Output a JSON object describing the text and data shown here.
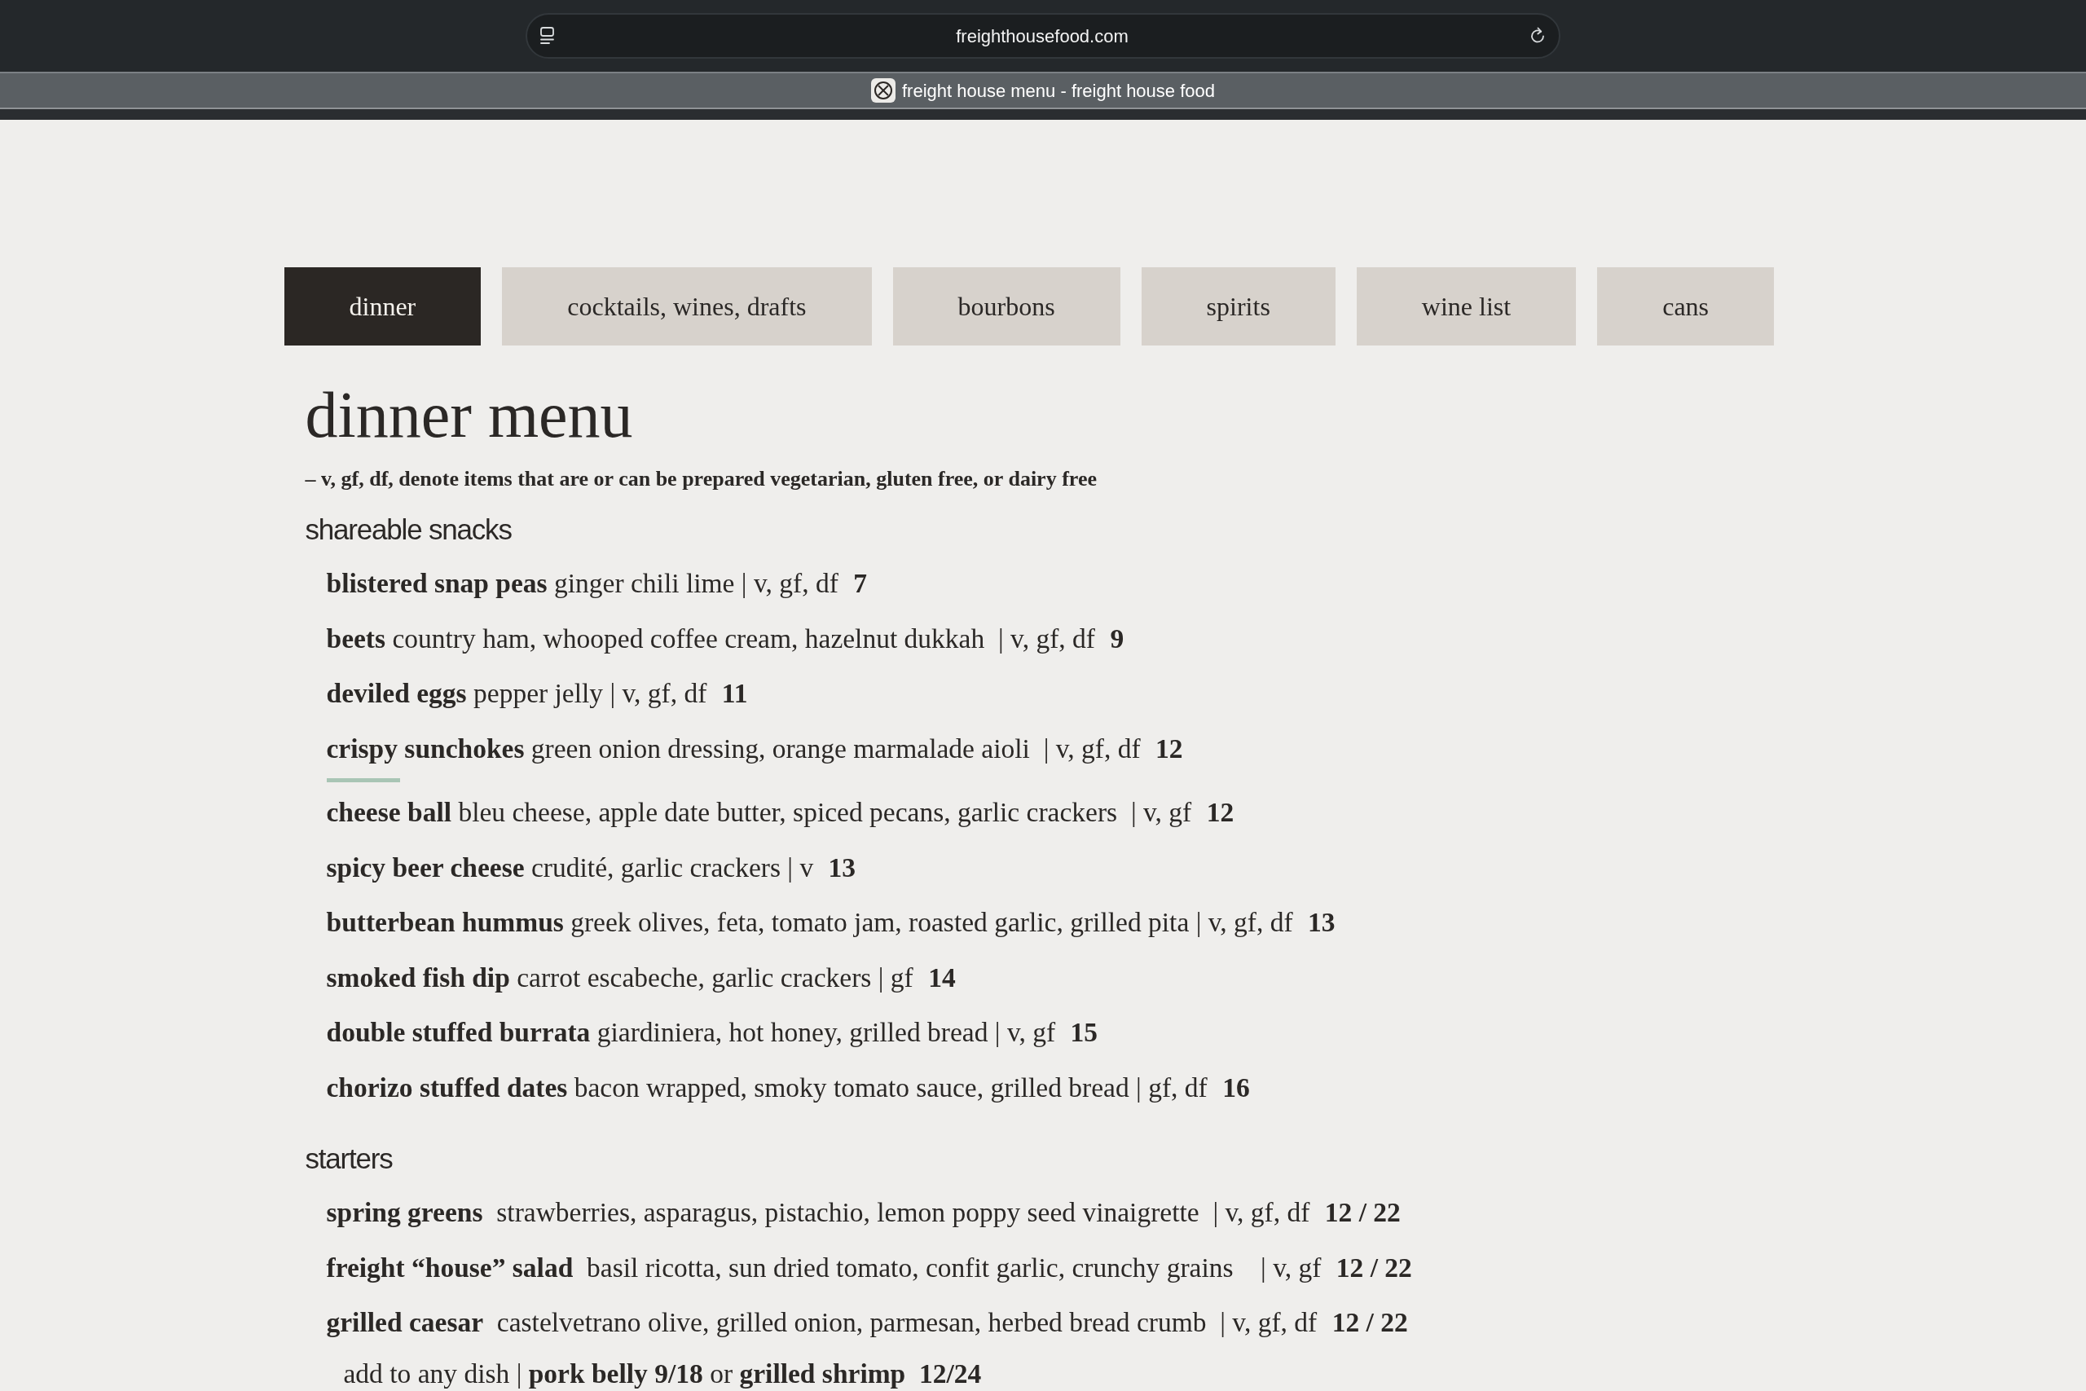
{
  "browser": {
    "url": "freighthousefood.com",
    "tab_title": "freight house menu - freight house food"
  },
  "menu_tabs": [
    {
      "label": "dinner",
      "selected": true
    },
    {
      "label": "cocktails, wines, drafts",
      "selected": false
    },
    {
      "label": "bourbons",
      "selected": false
    },
    {
      "label": "spirits",
      "selected": false
    },
    {
      "label": "wine list",
      "selected": false
    },
    {
      "label": "cans",
      "selected": false
    }
  ],
  "page": {
    "heading": "dinner menu",
    "note": "– v, gf, df, denote items that are or can be prepared vegetarian, gluten free, or dairy free"
  },
  "sections": [
    {
      "title": "shareable snacks",
      "items": [
        {
          "kind": "dish",
          "name": "blistered snap peas",
          "description": "ginger chili lime | v, gf, df",
          "price": "7"
        },
        {
          "kind": "dish",
          "name": "beets",
          "description": "country ham, whooped coffee cream, hazelnut dukkah  | v, gf, df",
          "price": "9"
        },
        {
          "kind": "dish",
          "name": "deviled eggs",
          "description": "pepper jelly | v, gf, df",
          "price": "11"
        },
        {
          "kind": "dish",
          "name": "crispy sunchokes",
          "description": "green onion dressing, orange marmalade aioli  | v, gf, df",
          "price": "12"
        },
        {
          "kind": "rule"
        },
        {
          "kind": "dish",
          "name": "cheese ball",
          "description": "bleu cheese, apple date butter, spiced pecans, garlic crackers  | v, gf",
          "price": "12"
        },
        {
          "kind": "dish",
          "name": "spicy beer cheese",
          "description": "crudité, garlic crackers | v",
          "price": "13"
        },
        {
          "kind": "dish",
          "name": "butterbean hummus",
          "description": "greek olives, feta, tomato jam, roasted garlic, grilled pita | v, gf, df",
          "price": "13"
        },
        {
          "kind": "dish",
          "name": "smoked fish dip",
          "description": "carrot escabeche, garlic crackers | gf",
          "price": "14"
        },
        {
          "kind": "dish",
          "name": "double stuffed burrata",
          "description": "giardiniera, hot honey, grilled bread | v, gf",
          "price": "15"
        },
        {
          "kind": "dish",
          "name": "chorizo stuffed dates",
          "description": "bacon wrapped, smoky tomato sauce, grilled bread | gf, df",
          "price": "16"
        }
      ]
    },
    {
      "title": "starters",
      "items": [
        {
          "kind": "dish",
          "name": "spring greens",
          "description": " strawberries, asparagus, pistachio, lemon poppy seed vinaigrette  | v, gf, df",
          "price": "12 / 22"
        },
        {
          "kind": "dish",
          "name": "freight “house” salad",
          "description": " basil ricotta, sun dried tomato, confit garlic, crunchy grains    | v, gf",
          "price": "12 / 22"
        },
        {
          "kind": "dish",
          "name": "grilled caesar",
          "description": " castelvetrano olive, grilled onion, parmesan, herbed bread crumb  | v, gf, df",
          "price": "12 / 22"
        },
        {
          "kind": "addon",
          "text": "add to any dish | **pork belly 9/18** or **grilled shrimp  12/24**"
        }
      ]
    }
  ]
}
